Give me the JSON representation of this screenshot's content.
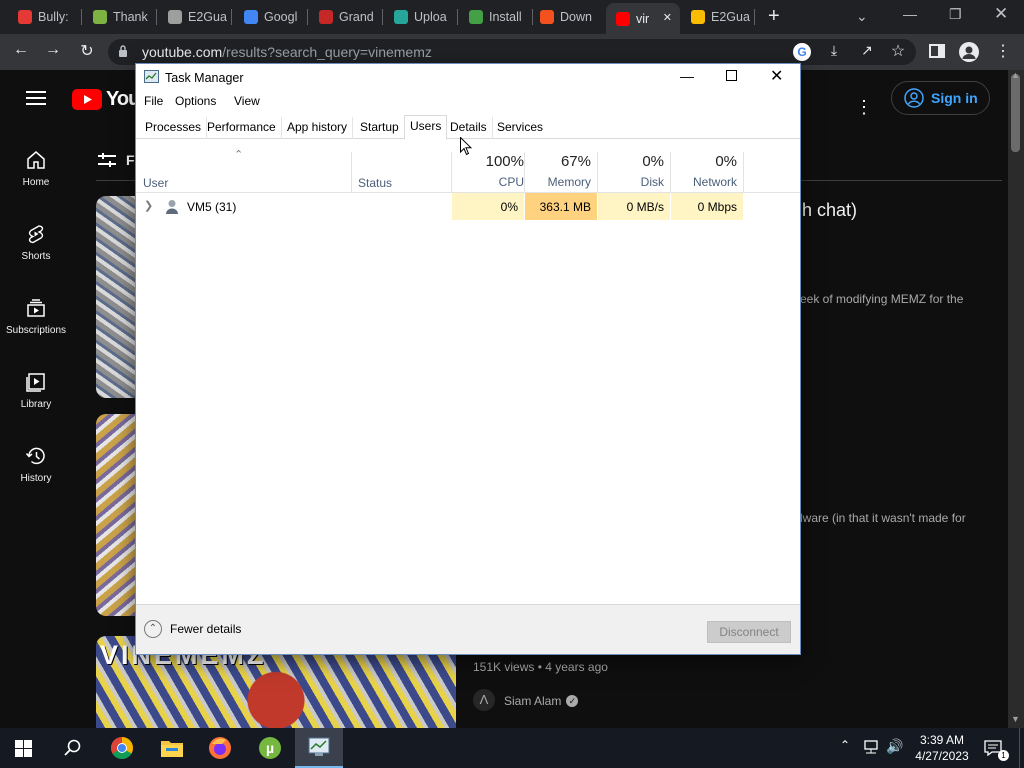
{
  "browser": {
    "tabs": [
      {
        "title": "Bully:",
        "color": "#e53935"
      },
      {
        "title": "Thank",
        "color": "#7cb342"
      },
      {
        "title": "E2Gua",
        "color": "#9e9e9e"
      },
      {
        "title": "Googl",
        "color": "#4285f4"
      },
      {
        "title": "Grand",
        "color": "#c62828"
      },
      {
        "title": "Uploa",
        "color": "#26a69a"
      },
      {
        "title": "Install",
        "color": "#43a047"
      },
      {
        "title": "Down",
        "color": "#f4511e"
      },
      {
        "title": "vir",
        "color": "#ff0000"
      },
      {
        "title": "E2Gua",
        "color": "#fbbc04"
      }
    ],
    "url_host": "youtube.com",
    "url_path": "/results?search_query=vinememz"
  },
  "youtube": {
    "logo_text": "YouT",
    "sign_in": "Sign in",
    "filters_label": "F",
    "nav": [
      {
        "label": "Home",
        "icon": "home-icon"
      },
      {
        "label": "Shorts",
        "icon": "shorts-icon"
      },
      {
        "label": "Subscriptions",
        "icon": "subscriptions-icon"
      },
      {
        "label": "Library",
        "icon": "library-icon"
      },
      {
        "label": "History",
        "icon": "history-icon"
      }
    ],
    "video1_title_tail": "h chat)",
    "video1_desc_tail": "eek of modifying MEMZ for the",
    "video2_desc_tail": "lware (in that it wasn't made for",
    "video3_meta": "151K views • 4 years ago",
    "video3_channel": "Siam Alam",
    "video3_thumb_text": "VINEMEMZ"
  },
  "task_manager": {
    "title": "Task Manager",
    "menu": [
      "File",
      "Options",
      "View"
    ],
    "tabs": [
      "Processes",
      "Performance",
      "App history",
      "Startup",
      "Users",
      "Details",
      "Services"
    ],
    "active_tab": "Users",
    "columns": {
      "user": "User",
      "status": "Status",
      "cpu": {
        "pct": "100%",
        "label": "CPU"
      },
      "memory": {
        "pct": "67%",
        "label": "Memory"
      },
      "disk": {
        "pct": "0%",
        "label": "Disk"
      },
      "network": {
        "pct": "0%",
        "label": "Network"
      }
    },
    "rows": [
      {
        "user": "VM5 (31)",
        "status": "",
        "cpu": "0%",
        "memory": "363.1 MB",
        "disk": "0 MB/s",
        "network": "0 Mbps"
      }
    ],
    "fewer_details": "Fewer details",
    "disconnect": "Disconnect",
    "heat_colors": {
      "light": "#fff4c4",
      "memory": "#ffd27f"
    }
  },
  "taskbar": {
    "time": "3:39 AM",
    "date": "4/27/2023",
    "apps": [
      "chrome-icon",
      "file-explorer-icon",
      "firefox-icon",
      "utorrent-icon",
      "task-manager-icon"
    ]
  }
}
